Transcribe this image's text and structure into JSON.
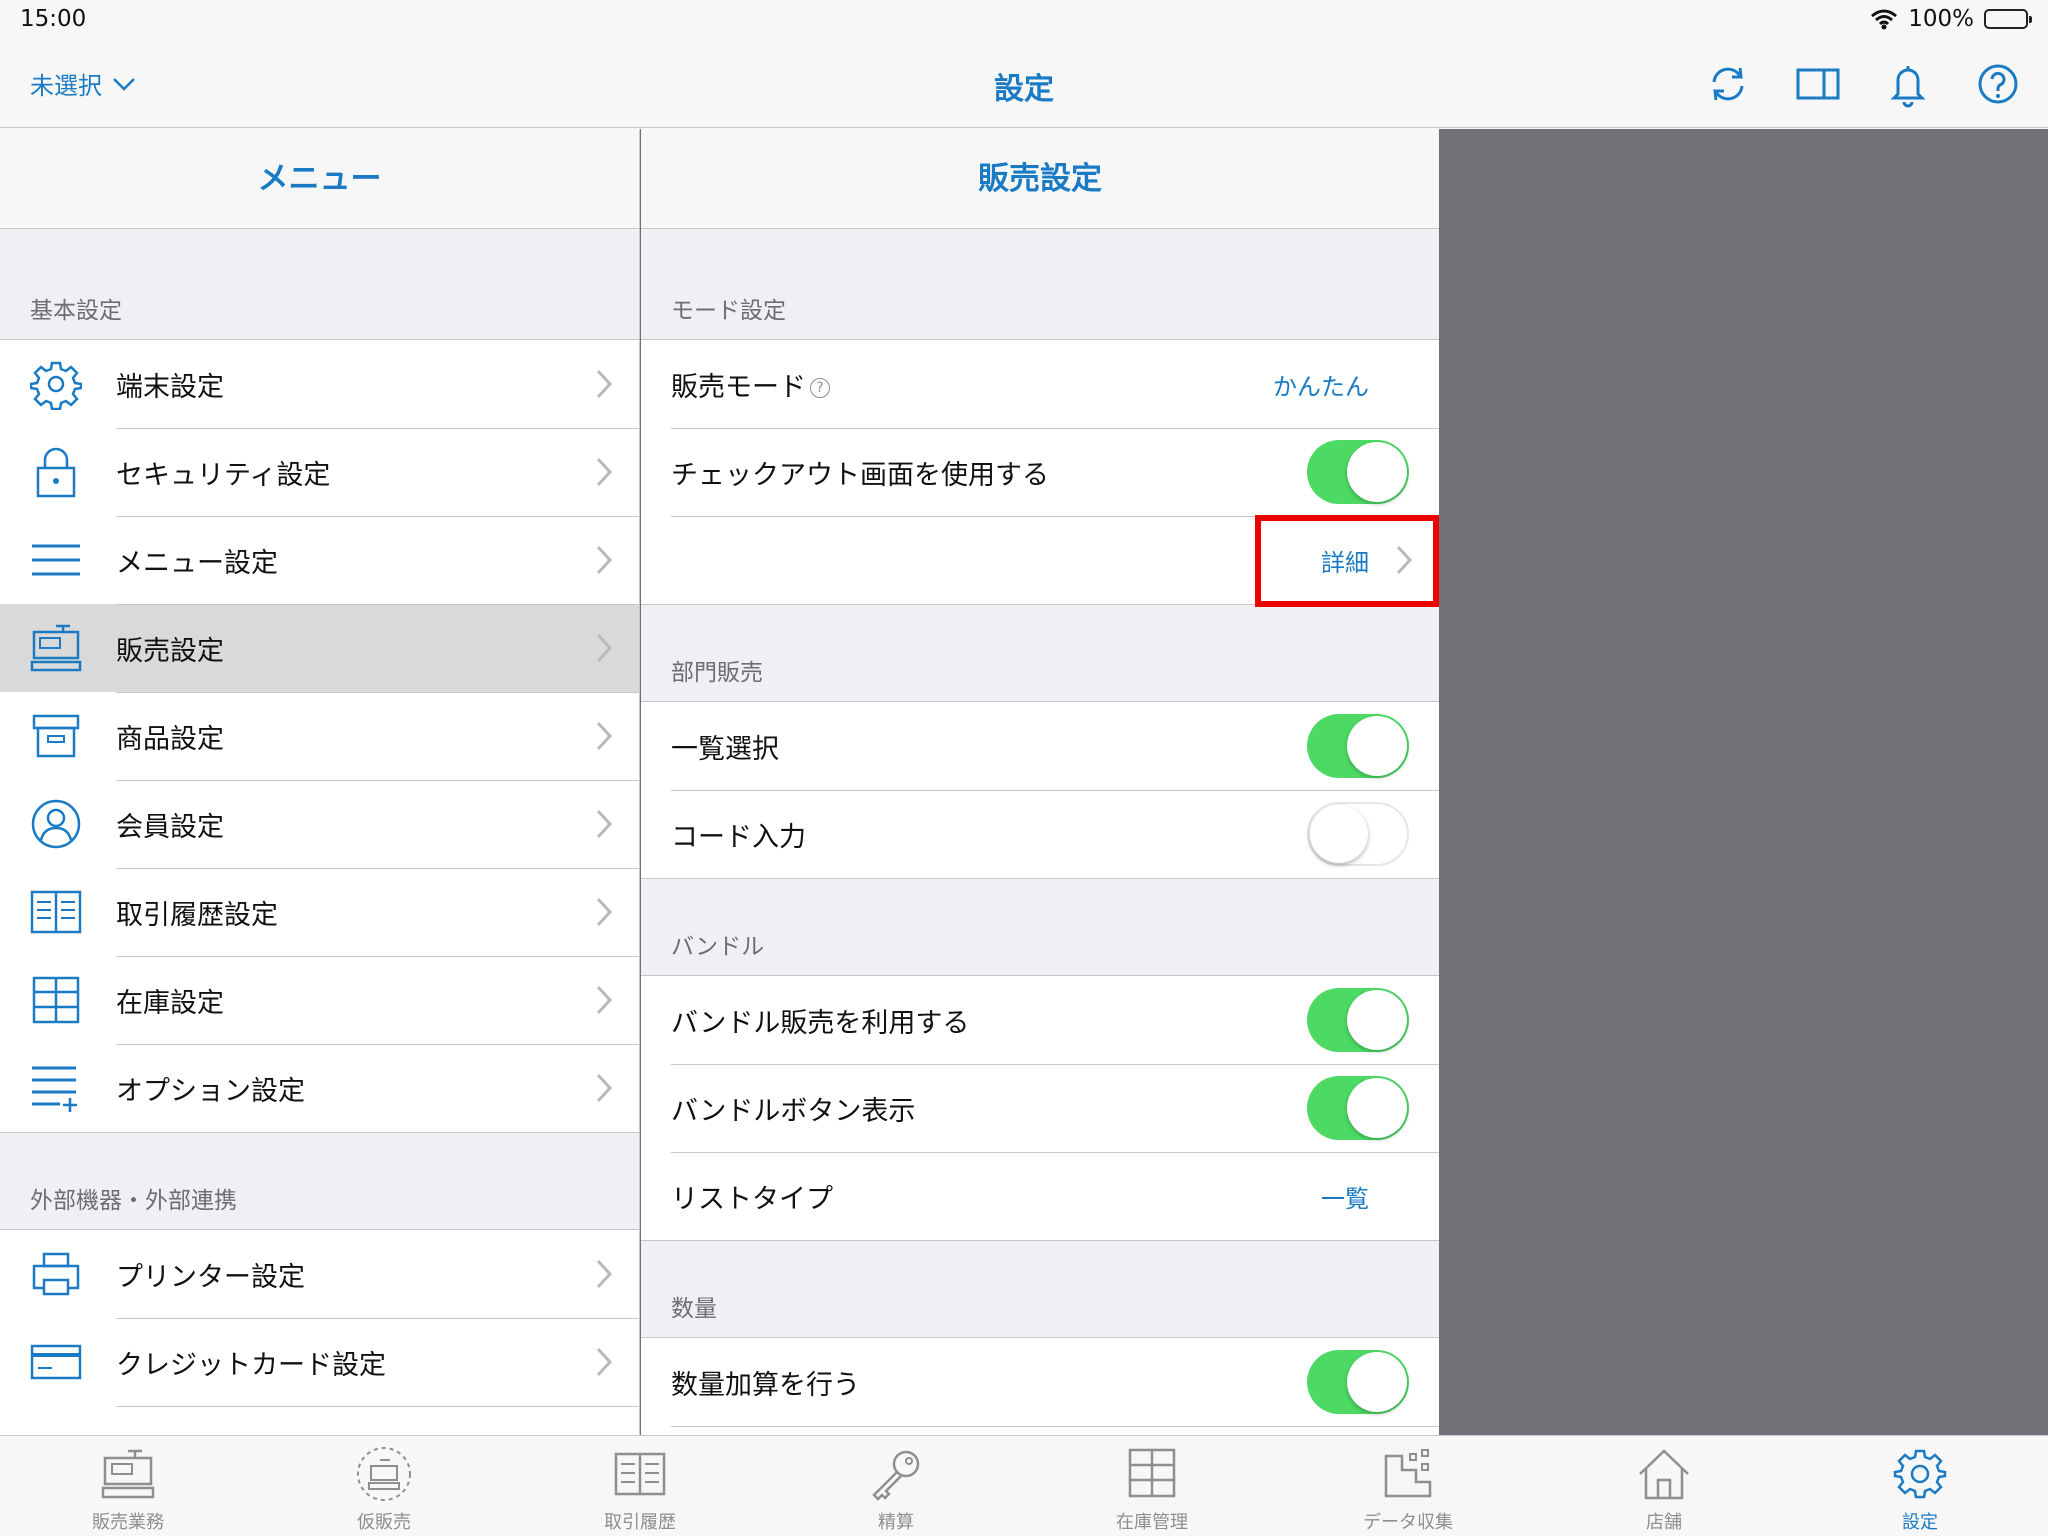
{
  "status_bar": {
    "time": "15:00",
    "battery": "100%"
  },
  "nav": {
    "store_selector": "未選択",
    "title": "設定"
  },
  "menu": {
    "header": "メニュー",
    "sections": [
      {
        "title": "基本設定",
        "items": [
          {
            "label": "端末設定",
            "icon": "gear-icon"
          },
          {
            "label": "セキュリティ設定",
            "icon": "lock-icon"
          },
          {
            "label": "メニュー設定",
            "icon": "menu-lines-icon"
          },
          {
            "label": "販売設定",
            "icon": "register-icon",
            "selected": true
          },
          {
            "label": "商品設定",
            "icon": "box-icon"
          },
          {
            "label": "会員設定",
            "icon": "person-icon"
          },
          {
            "label": "取引履歴設定",
            "icon": "book-icon"
          },
          {
            "label": "在庫設定",
            "icon": "shelf-icon"
          },
          {
            "label": "オプション設定",
            "icon": "list-plus-icon"
          }
        ]
      },
      {
        "title": "外部機器・外部連携",
        "items": [
          {
            "label": "プリンター設定",
            "icon": "printer-icon"
          },
          {
            "label": "クレジットカード設定",
            "icon": "credit-card-icon"
          }
        ]
      }
    ]
  },
  "sales": {
    "header": "販売設定",
    "mode_section": {
      "title": "モード設定",
      "sales_mode_label": "販売モード",
      "sales_mode_value": "かんたん",
      "checkout_label": "チェックアウト画面を使用する",
      "detail_label": "詳細"
    },
    "dept_section": {
      "title": "部門販売",
      "list_select_label": "一覧選択",
      "code_input_label": "コード入力"
    },
    "bundle_section": {
      "title": "バンドル",
      "use_bundle_label": "バンドル販売を利用する",
      "bundle_button_label": "バンドルボタン表示",
      "list_type_label": "リストタイプ",
      "list_type_value": "一覧"
    },
    "qty_section": {
      "title": "数量",
      "qty_add_label": "数量加算を行う"
    }
  },
  "tabs": [
    {
      "label": "販売業務",
      "icon": "register-icon"
    },
    {
      "label": "仮販売",
      "icon": "temp-register-icon"
    },
    {
      "label": "取引履歴",
      "icon": "book-icon"
    },
    {
      "label": "精算",
      "icon": "key-icon"
    },
    {
      "label": "在庫管理",
      "icon": "shelf-icon"
    },
    {
      "label": "データ収集",
      "icon": "data-icon"
    },
    {
      "label": "店舗",
      "icon": "house-icon"
    },
    {
      "label": "設定",
      "icon": "gear-icon",
      "active": true
    }
  ],
  "colors": {
    "accent": "#1a7bc4",
    "toggle_on": "#4cd964",
    "highlight": "#ec0000",
    "backdrop": "#6f7177"
  }
}
